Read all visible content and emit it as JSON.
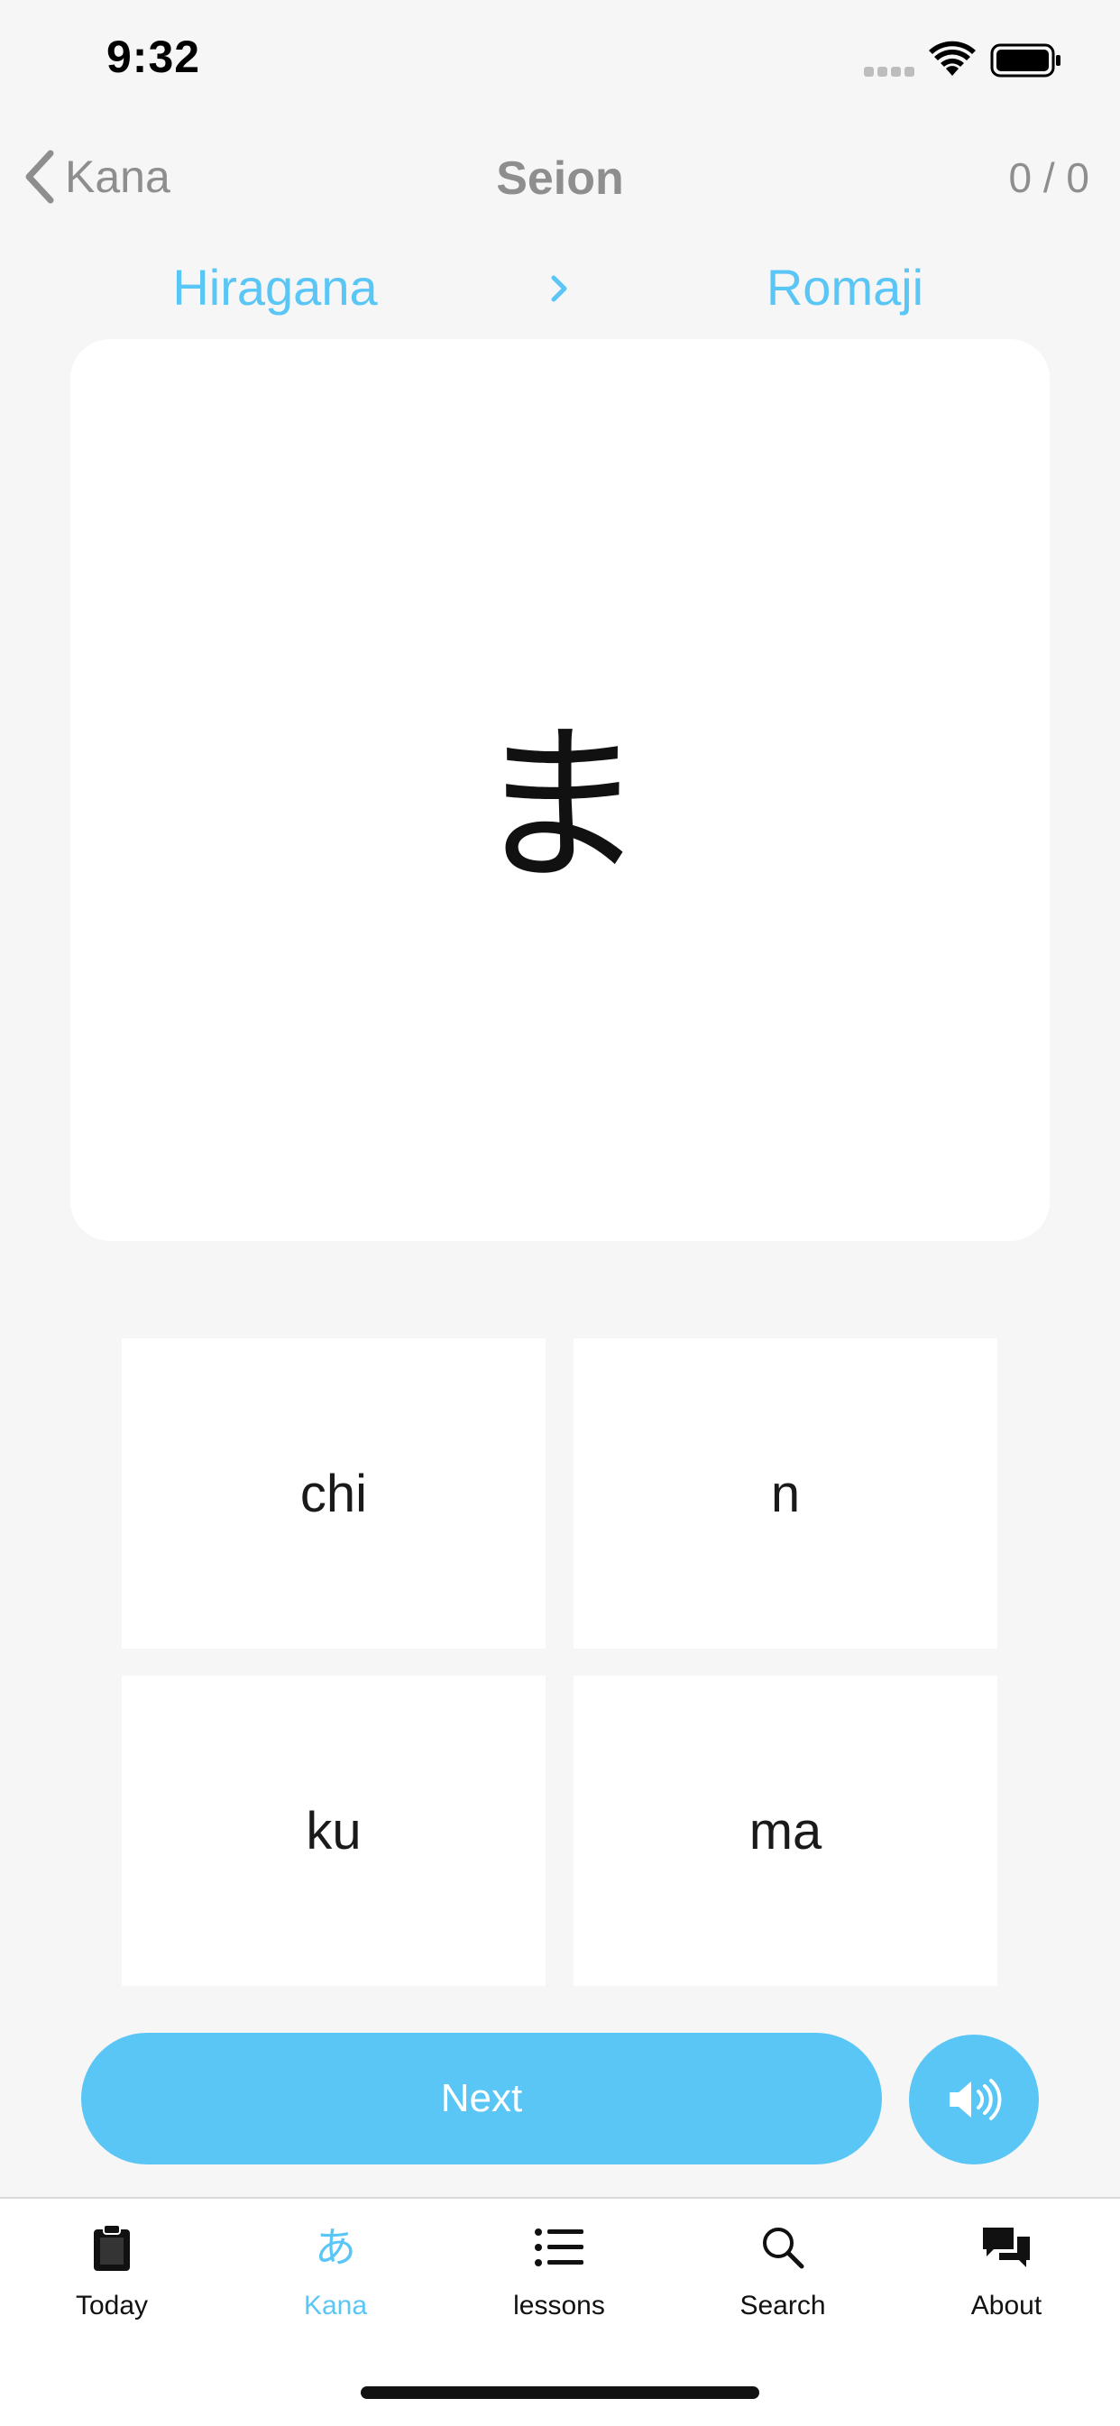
{
  "status_bar": {
    "time": "9:32"
  },
  "nav": {
    "back_label": "Kana",
    "title": "Seion",
    "progress": "0 / 0"
  },
  "direction": {
    "from": "Hiragana",
    "to": "Romaji"
  },
  "card": {
    "character": "ま"
  },
  "options": [
    "chi",
    "n",
    "ku",
    "ma"
  ],
  "actions": {
    "next_label": "Next"
  },
  "tabs": [
    {
      "label": "Today",
      "icon": "clipboard-icon"
    },
    {
      "label": "Kana",
      "icon": "hiragana-a-icon",
      "glyph": "あ",
      "active": true
    },
    {
      "label": "lessons",
      "icon": "list-icon"
    },
    {
      "label": "Search",
      "icon": "search-icon"
    },
    {
      "label": "About",
      "icon": "chat-bubbles-icon"
    }
  ],
  "colors": {
    "accent": "#5ac6f6",
    "background": "#f6f6f6",
    "muted_text": "#8e8e8e"
  }
}
